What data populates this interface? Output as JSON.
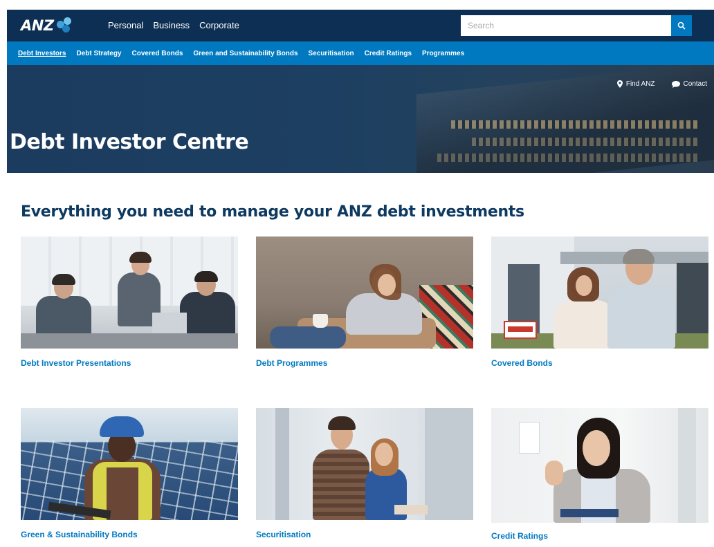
{
  "topnav": {
    "logo": "ANZ",
    "menu": [
      "Personal",
      "Business",
      "Corporate"
    ],
    "search_placeholder": "Search"
  },
  "subnav": {
    "items": [
      "Debt Investors",
      "Debt Strategy",
      "Covered Bonds",
      "Green and Sustainability Bonds",
      "Securitisation",
      "Credit Ratings",
      "Programmes"
    ],
    "active_index": 0
  },
  "hero": {
    "title": "Debt Investor Centre",
    "find_anz": "Find ANZ",
    "contact": "Contact"
  },
  "main": {
    "heading": "Everything you need to manage your ANZ debt investments",
    "cards": [
      {
        "label": "Debt Investor Presentations",
        "image": "business-meeting-photo"
      },
      {
        "label": "Debt Programmes",
        "image": "woman-on-sofa-photo"
      },
      {
        "label": "Covered Bonds",
        "image": "couple-house-sold-photo"
      },
      {
        "label": "Green & Sustainability Bonds",
        "image": "worker-solar-panels-photo"
      },
      {
        "label": "Securitisation",
        "image": "couple-doorway-photo"
      },
      {
        "label": "Credit Ratings",
        "image": "woman-with-clipboard-photo"
      }
    ]
  },
  "colors": {
    "navy": "#0e2f54",
    "brand_blue": "#0079c1",
    "heading": "#0e3a61"
  }
}
